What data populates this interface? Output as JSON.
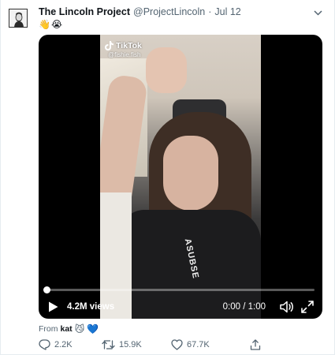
{
  "tweet": {
    "author_name": "The Lincoln Project",
    "handle": "@ProjectLincoln",
    "separator": "·",
    "date": "Jul 12",
    "text_emojis": [
      "👋",
      "😭"
    ]
  },
  "video": {
    "watermark_brand": "TikTok",
    "watermark_user": "@fishie.fish",
    "shirt_text": "ASUBSE",
    "views": "4.2M views",
    "time": "0:00 / 1:00",
    "progress": 0,
    "icons": [
      "play-icon",
      "volume-icon",
      "fullscreen-icon"
    ]
  },
  "source": {
    "prefix": "From",
    "user": "kat",
    "emojis": [
      "😼",
      "💙"
    ]
  },
  "actions": {
    "reply_count": "2.2K",
    "retweet_count": "15.9K",
    "like_count": "67.7K",
    "icons": [
      "reply-icon",
      "retweet-icon",
      "like-icon",
      "share-icon"
    ]
  },
  "colors": {
    "text_primary": "#0f1419",
    "text_secondary": "#536471",
    "video_bg": "#000000"
  }
}
